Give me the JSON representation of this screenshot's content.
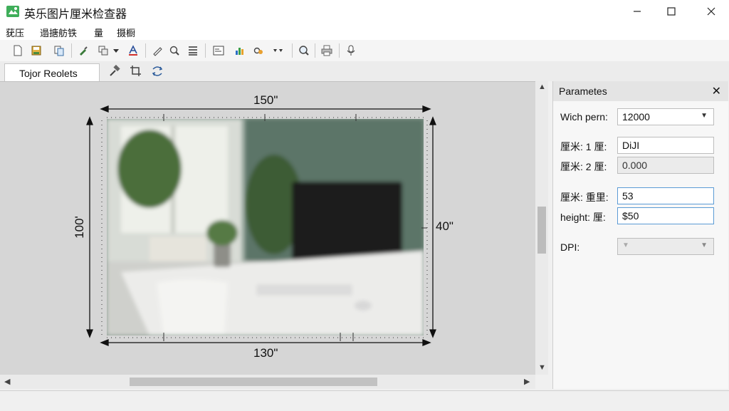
{
  "window": {
    "title": "英乐图片厘米检查器",
    "controls": [
      "minimize",
      "maximize",
      "close"
    ]
  },
  "menu": [
    "莸压",
    "遢搪舫铁",
    "量",
    "摄橱"
  ],
  "toolbar": {
    "icons": [
      "new-file-icon",
      "save-icon",
      "copy-icon",
      "brush-icon",
      "crop-icon",
      "dropdown-icon",
      "text-color-icon",
      "pen-icon",
      "zoom-icon",
      "list-icon",
      "form-icon",
      "chart-icon",
      "link-icon",
      "more-dropdown-icon",
      "search-icon",
      "printer-icon",
      "microphone-icon"
    ]
  },
  "tab": {
    "label": "Tojor Reolets",
    "tools": [
      "hammer-icon",
      "crop-tool-icon",
      "transform-icon"
    ]
  },
  "canvas": {
    "dimensions": {
      "top": "150\"",
      "bottom": "130\"",
      "left": "100'",
      "right": "40\""
    }
  },
  "panel": {
    "title": "Parametes",
    "width_label": "Wich pern:",
    "width_value": "12000",
    "cm1_label": "厘米: 1 厘:",
    "cm1_value": "DiJI",
    "cm2_label": "厘米: 2 厘:",
    "cm2_value": "0.000",
    "cm3_label": "厘米: 重里:",
    "cm3_value": "53",
    "height_label": "height: 厘:",
    "height_value": "$50",
    "dpi_label": "DPI:",
    "dpi_value": ""
  }
}
